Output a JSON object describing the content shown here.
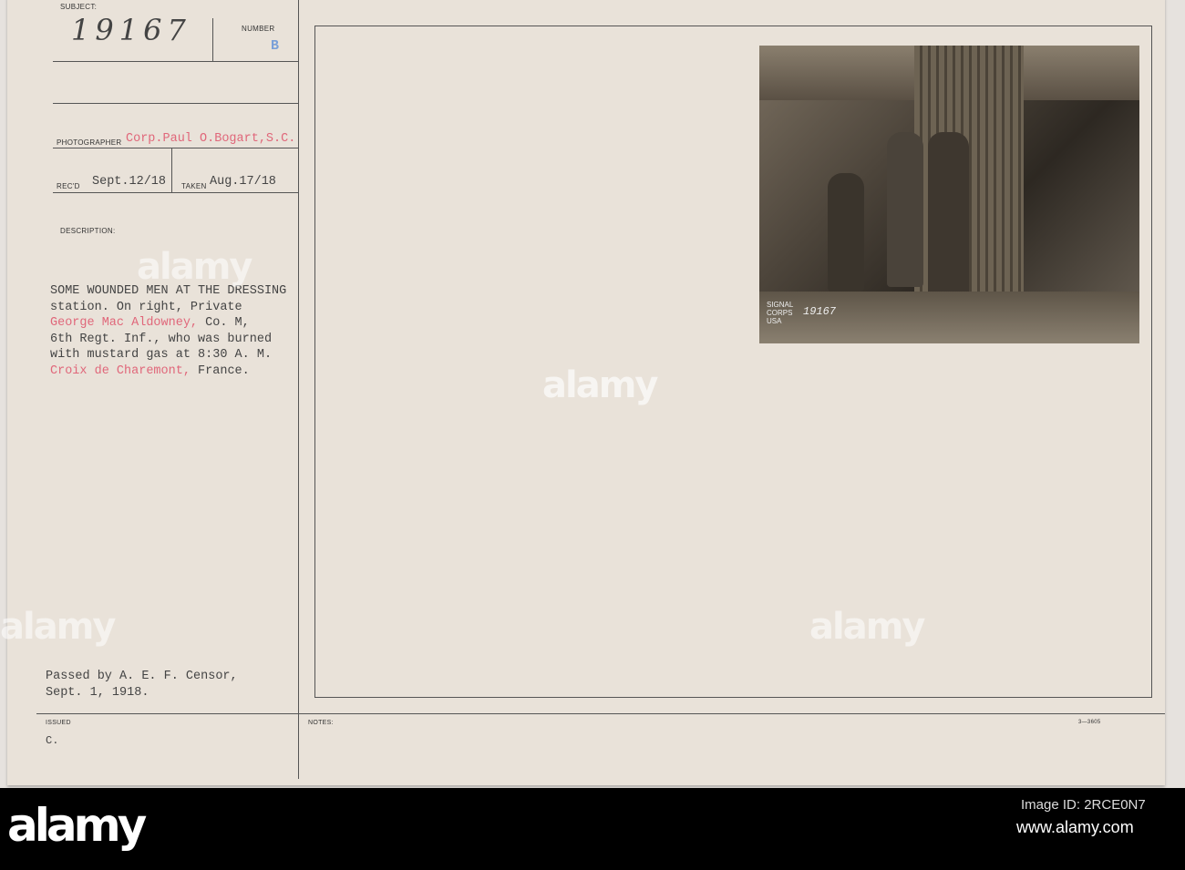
{
  "card": {
    "subject_label": "SUBJECT:",
    "subject_value": "19167",
    "number_label": "NUMBER",
    "number_value": "B",
    "photographer_label": "PHOTOGRAPHER",
    "photographer_value": "Corp.Paul O.Bogart,S.C.",
    "recd_label": "REC'D",
    "recd_value": "Sept.12/18",
    "taken_label": "TAKEN",
    "taken_value": "Aug.17/18",
    "description_label": "DESCRIPTION:",
    "description_lines": [
      {
        "parts": [
          "SOME WOUNDED MEN AT THE DRESSING"
        ]
      },
      {
        "parts": [
          "station. On right, Private"
        ]
      },
      {
        "parts": [
          "George Mac Aldowney,",
          " Co. M,"
        ]
      },
      {
        "parts": [
          "6th Regt. Inf., who was burned"
        ]
      },
      {
        "parts": [
          "with mustard gas at 8:30 A. M."
        ]
      },
      {
        "parts": [
          "Croix de ",
          "Charemont,",
          " France."
        ]
      }
    ],
    "censor_lines": [
      "Passed by A. E. F. Censor,",
      "Sept. 1, 1918."
    ],
    "issued_label": "ISSUED",
    "issued_value": "C.",
    "notes_label": "NOTES:",
    "form_number": "3—3605",
    "photo_stamp": "SIGNAL CORPS USA",
    "photo_number": "19167"
  },
  "watermark": "alamy",
  "footer": {
    "logo": "alamy",
    "image_id": "Image ID: 2RCE0N7",
    "url": "www.alamy.com"
  }
}
